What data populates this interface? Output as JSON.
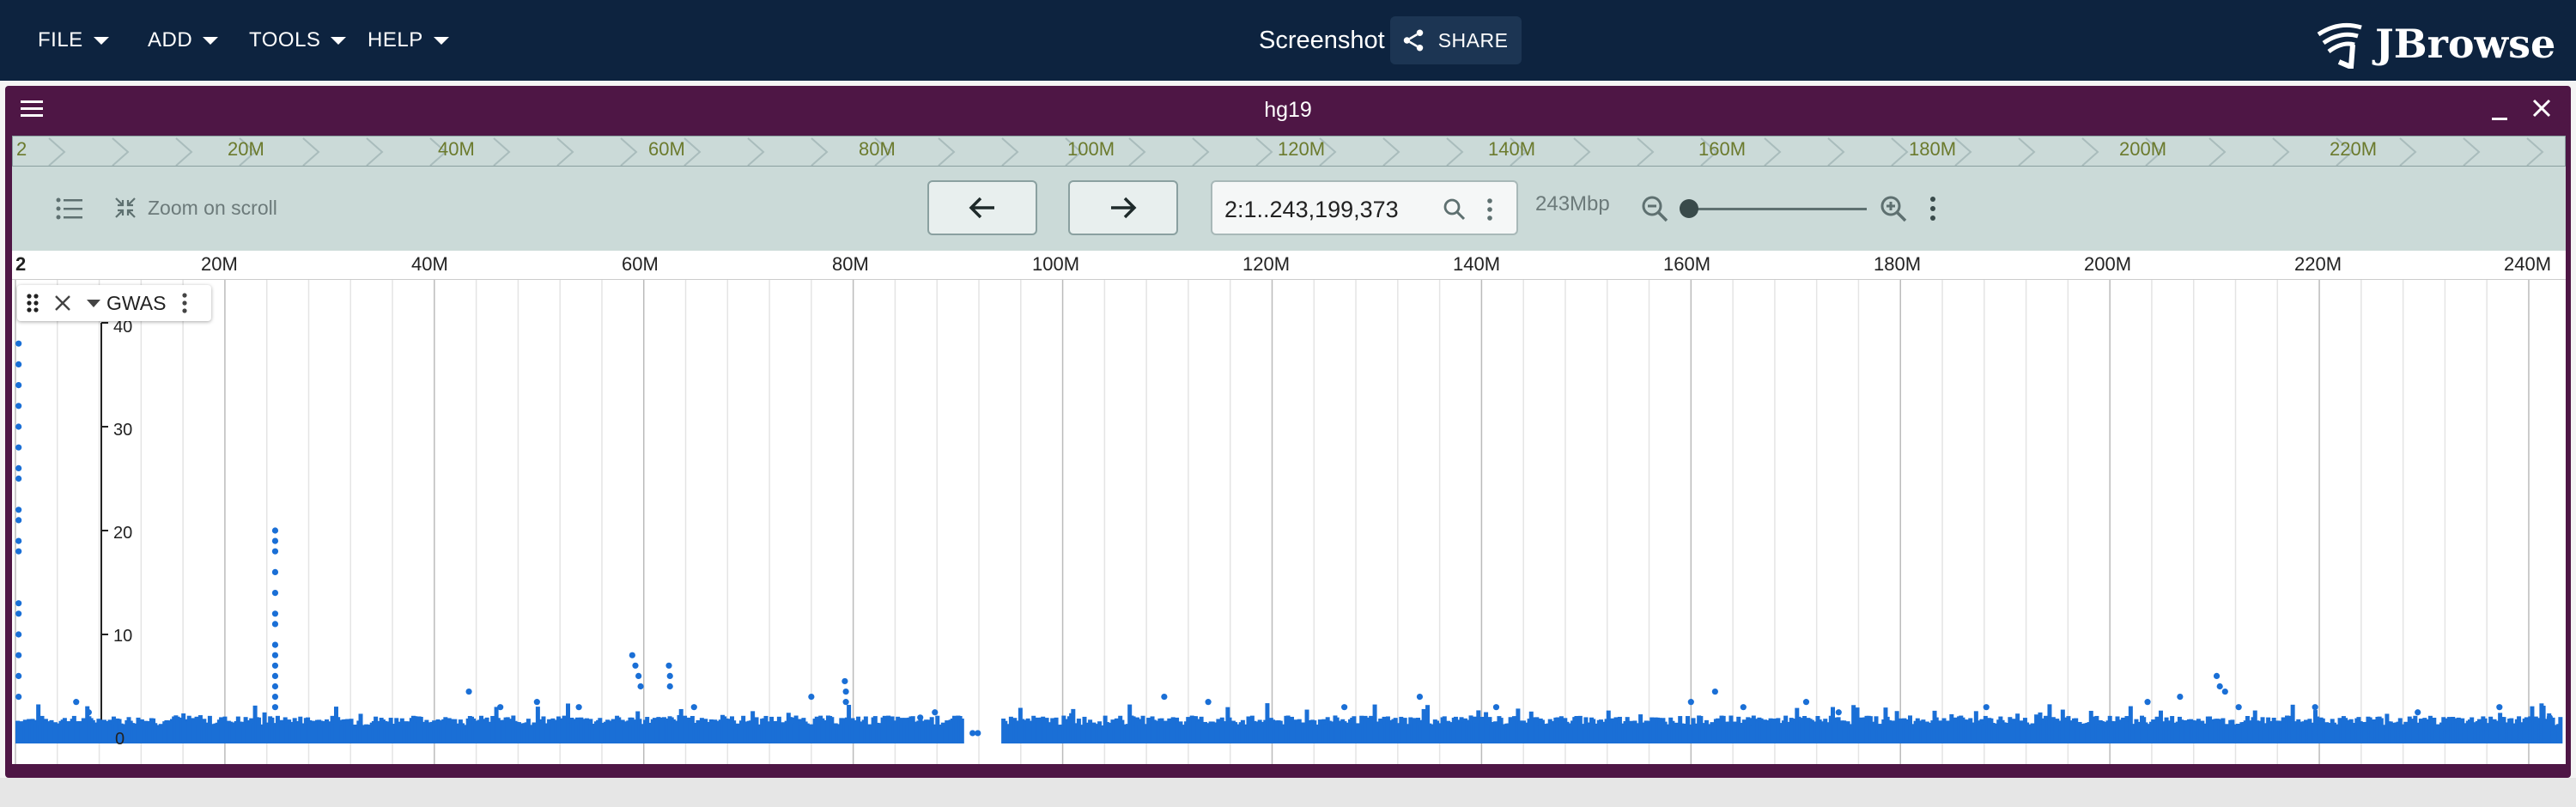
{
  "appbar": {
    "menus": [
      {
        "label": "FILE"
      },
      {
        "label": "ADD"
      },
      {
        "label": "TOOLS"
      },
      {
        "label": "HELP"
      }
    ],
    "title": "Screenshot",
    "share_label": "SHARE",
    "logo_text": "JBrowse"
  },
  "view": {
    "assembly": "hg19",
    "overview": {
      "chrom": "2",
      "labels": [
        "20M",
        "40M",
        "60M",
        "80M",
        "100M",
        "120M",
        "140M",
        "160M",
        "180M",
        "200M",
        "220M"
      ]
    },
    "controls": {
      "zoom_on_scroll": "Zoom on scroll",
      "location": "2:1..243,199,373",
      "bp_visible": "243Mbp",
      "zoom_level": 0.0
    },
    "ruler": {
      "chrom": "2",
      "labels": [
        "20M",
        "40M",
        "60M",
        "80M",
        "100M",
        "120M",
        "140M",
        "160M",
        "180M",
        "200M",
        "220M",
        "240M"
      ]
    },
    "track": {
      "name": "GWAS",
      "y_ticks": [
        "40",
        "30",
        "20",
        "10",
        "0"
      ]
    }
  },
  "colors": {
    "appbar": "#0d233f",
    "view_header": "#4e1645",
    "controls_bg": "#cbdad8",
    "dots": "#1a6fd6"
  },
  "chart_data": {
    "type": "scatter",
    "x_unit": "position on chromosome 2 (Mb)",
    "xlim": [
      0,
      243.2
    ],
    "ylim": [
      0,
      40
    ],
    "y_ticks": [
      0,
      10,
      20,
      30,
      40
    ],
    "series": [
      {
        "points": [
          [
            0.3,
            38
          ],
          [
            0.3,
            36
          ],
          [
            0.3,
            34
          ],
          [
            0.3,
            32
          ],
          [
            0.3,
            30
          ],
          [
            0.3,
            28
          ],
          [
            0.3,
            26
          ],
          [
            0.3,
            25
          ],
          [
            0.3,
            22
          ],
          [
            0.3,
            21
          ],
          [
            0.3,
            19
          ],
          [
            0.3,
            18
          ],
          [
            0.3,
            13
          ],
          [
            0.3,
            12
          ],
          [
            0.3,
            10
          ],
          [
            0.3,
            8
          ],
          [
            0.3,
            6
          ],
          [
            0.3,
            4
          ],
          [
            24.8,
            20
          ],
          [
            24.8,
            19
          ],
          [
            24.8,
            18
          ],
          [
            24.8,
            16
          ],
          [
            24.8,
            14
          ],
          [
            24.8,
            12
          ],
          [
            24.8,
            11
          ],
          [
            24.8,
            9
          ],
          [
            24.8,
            8
          ],
          [
            24.8,
            7
          ],
          [
            24.8,
            6
          ],
          [
            24.8,
            5
          ],
          [
            24.8,
            4
          ],
          [
            24.8,
            3
          ],
          [
            5.8,
            3.5
          ],
          [
            7.0,
            2.5
          ],
          [
            43.3,
            4.5
          ],
          [
            46.3,
            3
          ],
          [
            49.8,
            3.5
          ],
          [
            53.8,
            3
          ],
          [
            58.9,
            8
          ],
          [
            59.2,
            7
          ],
          [
            59.5,
            6
          ],
          [
            59.7,
            5
          ],
          [
            62.4,
            7
          ],
          [
            62.5,
            6
          ],
          [
            62.5,
            5
          ],
          [
            64.8,
            3
          ],
          [
            76.0,
            4
          ],
          [
            79.2,
            5.5
          ],
          [
            79.3,
            4.5
          ],
          [
            79.3,
            3.5
          ],
          [
            86.4,
            2
          ],
          [
            87.8,
            2.5
          ],
          [
            91.4,
            0.5
          ],
          [
            91.9,
            0.5
          ],
          [
            109.7,
            4
          ],
          [
            113.9,
            3.5
          ],
          [
            126.9,
            3
          ],
          [
            134.1,
            4
          ],
          [
            141.4,
            3
          ],
          [
            160.0,
            3.5
          ],
          [
            162.3,
            4.5
          ],
          [
            165.0,
            3
          ],
          [
            171.0,
            3.5
          ],
          [
            174.1,
            2.5
          ],
          [
            188.2,
            3
          ],
          [
            203.6,
            3.5
          ],
          [
            206.7,
            4
          ],
          [
            210.2,
            6
          ],
          [
            210.5,
            5
          ],
          [
            211.0,
            4.5
          ],
          [
            212.3,
            3
          ],
          [
            219.6,
            3
          ],
          [
            229.4,
            2.5
          ],
          [
            237.2,
            3
          ],
          [
            242.0,
            2
          ]
        ]
      }
    ],
    "baseline_band": "dense low values (~0–2) across 0–90 Mb and 94–243 Mb; gap near 90–94 Mb"
  }
}
